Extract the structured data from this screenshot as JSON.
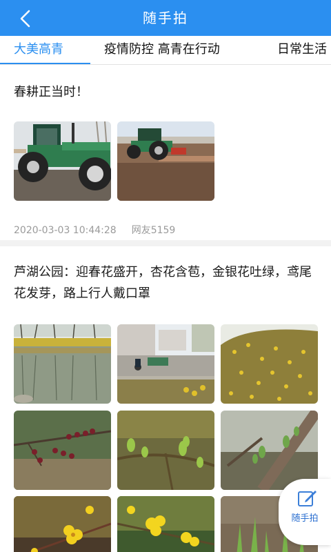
{
  "header": {
    "title": "随手拍"
  },
  "tabs": [
    {
      "label": "大美高青",
      "active": true
    },
    {
      "label": "疫情防控 高青在行动",
      "active": false
    },
    {
      "label": "日常生活",
      "active": false
    }
  ],
  "posts": [
    {
      "text": "春耕正当时！",
      "date": "2020-03-03 10:44:28",
      "author": "网友5159",
      "photos": [
        "tractor-photo",
        "tractor-plowing-photo"
      ]
    },
    {
      "text": "芦湖公园：迎春花盛开，杏花含苞，金银花吐绿，鸢尾花发芽，路上行人戴口罩",
      "photos": [
        "lake-reflection-photo",
        "street-cyclists-photo",
        "winter-jasmine-bush-photo",
        "apricot-buds-photo",
        "green-buds-photo",
        "honeysuckle-shoots-photo",
        "yellow-jasmine-flowers-photo",
        "yellow-jasmine-closeup-photo",
        "iris-sprouts-photo"
      ]
    }
  ],
  "fab": {
    "label": "随手拍",
    "icon": "edit-icon"
  },
  "colors": {
    "accent": "#2b8ff0",
    "background": "#f2f2f2",
    "meta": "#9a9a9a"
  }
}
